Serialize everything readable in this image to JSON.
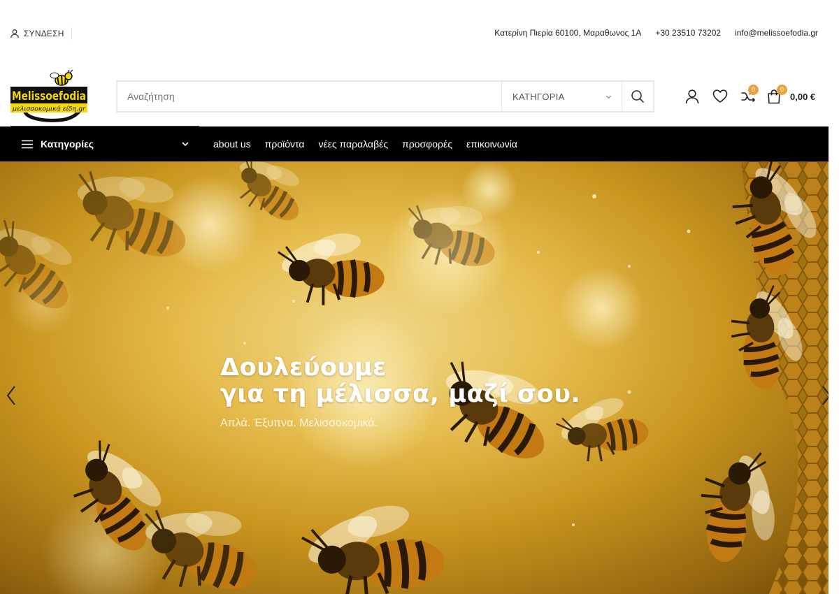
{
  "topbar": {
    "login_label": "ΣΥΝΔΕΣΗ",
    "address": "Κατερίνη Πιερία 60100, Μαραθωνος 1Α",
    "phone": "+30 23510 73202",
    "email": "info@melissoefodia.gr"
  },
  "logo": {
    "text": "Melissoefodia",
    "tagline": "μελισσοκομικά είδη.gr"
  },
  "search": {
    "placeholder": "Αναζήτηση",
    "category_label": "ΚΑΤΗΓΟΡΙΑ"
  },
  "header_icons": {
    "compare_count": "0",
    "cart_count": "0",
    "cart_total": "0,00 €"
  },
  "nav": {
    "categories_label": "Κατηγορίες",
    "links": [
      "about us",
      "προϊόντα",
      "νέες παραλαβές",
      "προσφορές",
      "επικοινωνία"
    ]
  },
  "hero": {
    "title_line1": "Δουλεύουμε",
    "title_line2": "για τη μέλισσα, μαζί σου.",
    "subtitle": "Απλά. Έξυπνα. Μελισσοκομικά."
  },
  "colors": {
    "accent": "#e8a33d",
    "nav_bg": "#000000",
    "logo_yellow": "#f5d90a"
  },
  "icons": [
    "user-icon",
    "search-icon",
    "chevron-down-icon",
    "heart-icon",
    "compare-icon",
    "cart-icon",
    "menu-icon",
    "chevron-left-icon",
    "chevron-right-icon"
  ]
}
